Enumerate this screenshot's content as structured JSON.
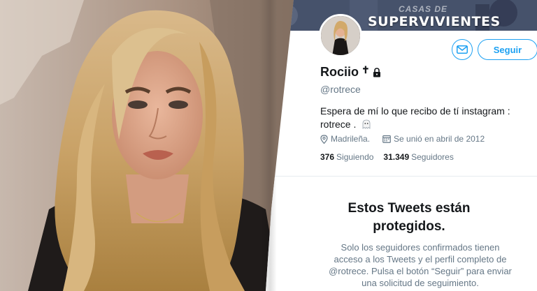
{
  "banner": {
    "subtitle": "CASAS DE",
    "title": "SUPERVIVIENTES"
  },
  "profile": {
    "name": "Rociio",
    "name_suffix": "✝",
    "handle": "@rotrece",
    "bio": "Espera de mí lo que recibo de tí instagram : rotrece .",
    "location": "Madrileña.",
    "joined": "Se unió en abril de 2012",
    "following_count": "376",
    "following_label": "Siguiendo",
    "followers_count": "31.349",
    "followers_label": "Seguidores"
  },
  "buttons": {
    "follow_label": "Seguir"
  },
  "protected": {
    "title": "Estos Tweets están protegidos.",
    "body": "Solo los seguidores confirmados tienen acceso a los Tweets y el perfil completo de @rotrece. Pulsa el botón “Seguir” para enviar una solicitud de seguimiento."
  },
  "icons": {
    "lock": "lock-icon",
    "message": "envelope-icon",
    "location": "map-pin-icon",
    "calendar": "calendar-icon",
    "emoji": "ghost-emoji-icon"
  },
  "colors": {
    "accent": "#1da1f2",
    "text": "#14171a",
    "muted": "#657786"
  }
}
